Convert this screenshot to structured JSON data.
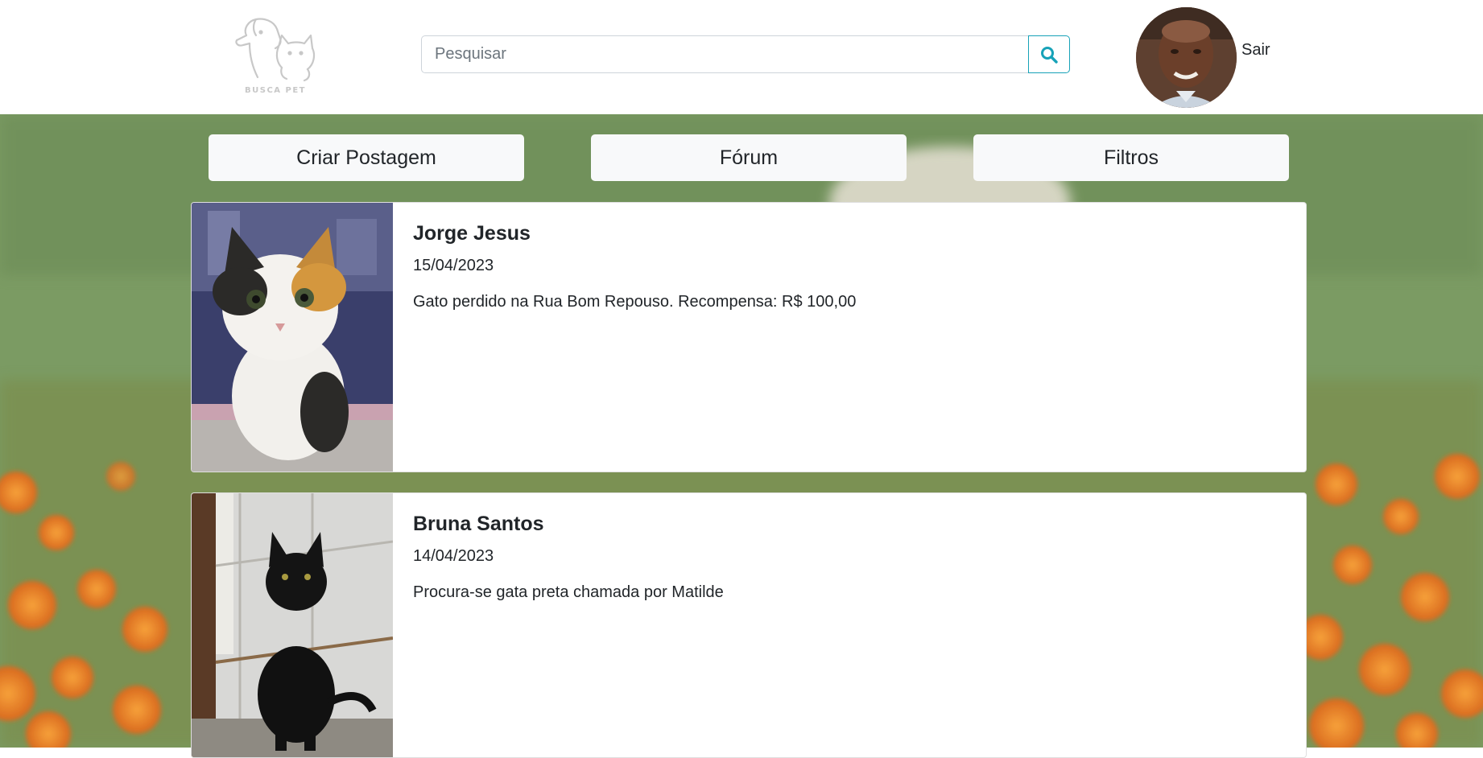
{
  "header": {
    "logo_text": "BUSCA PET",
    "search": {
      "placeholder": "Pesquisar",
      "value": ""
    },
    "logout_label": "Sair"
  },
  "nav": {
    "create_post": "Criar Postagem",
    "forum": "Fórum",
    "filters": "Filtros"
  },
  "posts": [
    {
      "author": "Jorge Jesus",
      "date": "15/04/2023",
      "text": "Gato perdido na Rua Bom Repouso. Recompensa: R$ 100,00"
    },
    {
      "author": "Bruna Santos",
      "date": "14/04/2023",
      "text": "Procura-se gata preta chamada por Matilde"
    }
  ],
  "colors": {
    "accent": "#17a2b8",
    "button_bg": "#f8f9fa",
    "header_bg": "#ffffff"
  }
}
